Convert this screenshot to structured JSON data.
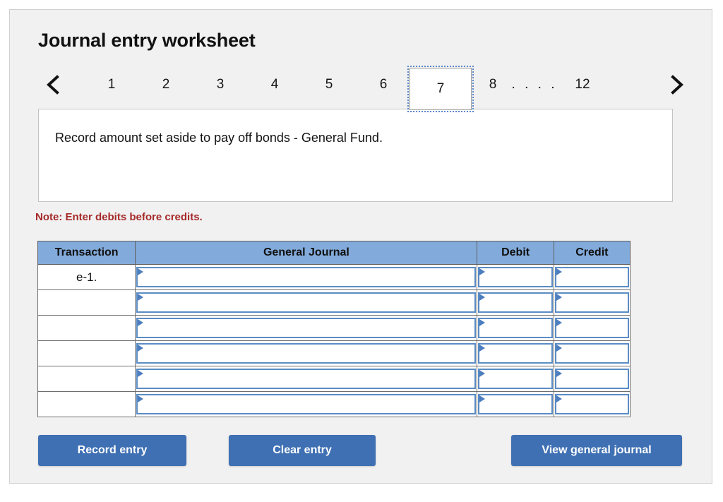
{
  "page": {
    "title": "Journal entry worksheet"
  },
  "pager": {
    "prev_icon": "chevron-left-icon",
    "next_icon": "chevron-right-icon",
    "pages": [
      "1",
      "2",
      "3",
      "4",
      "5",
      "6",
      "7",
      "8"
    ],
    "ellipsis": ". . . . .",
    "last_page": "12",
    "active_page": "7"
  },
  "description": {
    "text": "Record amount set aside to pay off bonds - General Fund."
  },
  "note": {
    "text": "Note: Enter debits before credits.",
    "color": "#a52a2a"
  },
  "table": {
    "headers": {
      "transaction": "Transaction",
      "general_journal": "General Journal",
      "debit": "Debit",
      "credit": "Credit"
    },
    "header_color": "#82aada",
    "rows": [
      {
        "transaction": "e-1.",
        "general_journal": "",
        "debit": "",
        "credit": ""
      },
      {
        "transaction": "",
        "general_journal": "",
        "debit": "",
        "credit": ""
      },
      {
        "transaction": "",
        "general_journal": "",
        "debit": "",
        "credit": ""
      },
      {
        "transaction": "",
        "general_journal": "",
        "debit": "",
        "credit": ""
      },
      {
        "transaction": "",
        "general_journal": "",
        "debit": "",
        "credit": ""
      },
      {
        "transaction": "",
        "general_journal": "",
        "debit": "",
        "credit": ""
      }
    ]
  },
  "buttons": {
    "record": "Record entry",
    "clear": "Clear entry",
    "view": "View general journal",
    "color": "#3f70b3"
  }
}
